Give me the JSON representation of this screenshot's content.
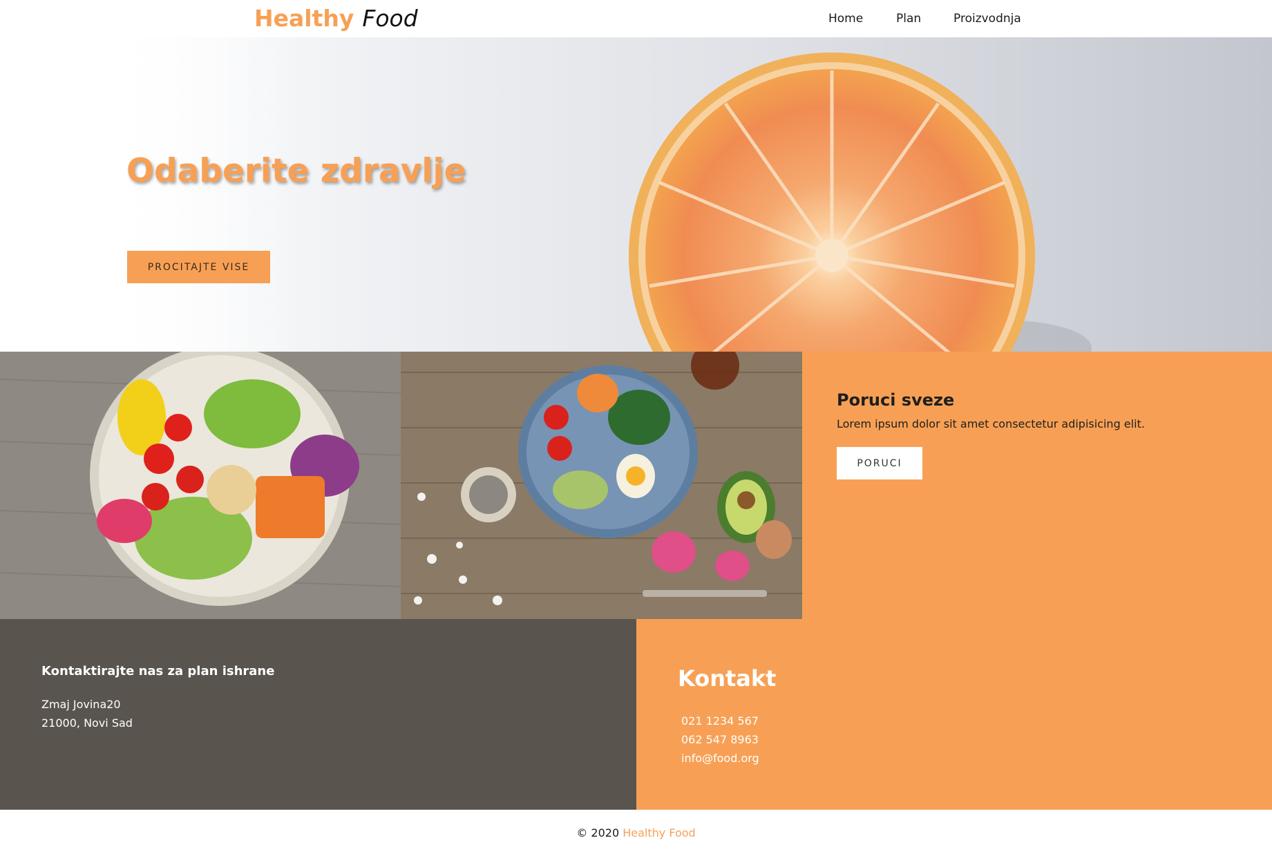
{
  "navbar": {
    "brand_part1": "Healthy",
    "brand_part2": "Food",
    "links": [
      "Home",
      "Plan",
      "Proizvodnja"
    ]
  },
  "hero": {
    "title": "Odaberite zdravlje",
    "button_label": "PROCITAJTE VISE"
  },
  "order": {
    "title": "Poruci sveze",
    "text": "Lorem ipsum dolor sit amet consectetur adipisicing elit.",
    "button_label": "PORUCI"
  },
  "contact_info": {
    "title": "Kontaktirajte nas za plan ishrane",
    "address_line1": "Zmaj Jovina20",
    "address_line2": "21000, Novi Sad"
  },
  "contact": {
    "title": "Kontakt",
    "phone1": "021 1234 567",
    "phone2": "062 547 8963",
    "email": "info@food.org"
  },
  "footer": {
    "copyright": "© 2020",
    "brand": "Healthy Food"
  },
  "colors": {
    "accent": "#f7a055",
    "dark_panel": "#59554e",
    "white": "#ffffff"
  }
}
